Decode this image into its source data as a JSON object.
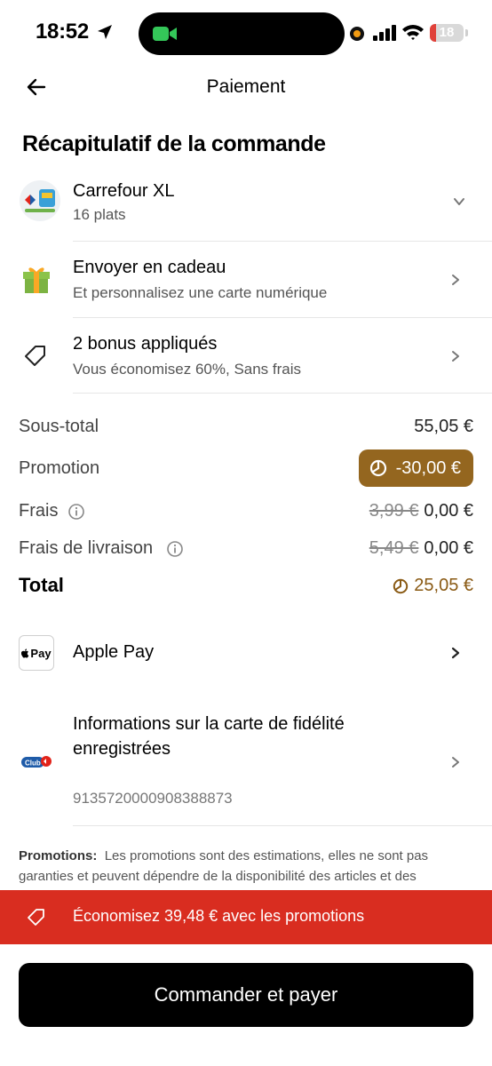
{
  "status_bar": {
    "time": "18:52",
    "battery": "18",
    "battery_level": 0.18
  },
  "header": {
    "title": "Paiement"
  },
  "summary": {
    "title": "Récapitulatif de la commande",
    "store": {
      "name": "Carrefour XL",
      "items": "16 plats"
    },
    "gift": {
      "title": "Envoyer en cadeau",
      "subtitle": "Et personnalisez une carte numérique"
    },
    "bonus": {
      "title": "2 bonus appliqués",
      "subtitle": "Vous économisez 60%, Sans frais"
    }
  },
  "pricing": {
    "subtotal_label": "Sous-total",
    "subtotal_value": "55,05 €",
    "promotion_label": "Promotion",
    "promotion_value": "-30,00 €",
    "fees_label": "Frais",
    "fees_old": "3,99 €",
    "fees_value": "0,00 €",
    "delivery_label": "Frais de livraison",
    "delivery_old": "5,49 €",
    "delivery_value": "0,00 €",
    "total_label": "Total",
    "total_value": "25,05 €"
  },
  "payment": {
    "method_badge": "Pay",
    "method_label": "Apple Pay"
  },
  "loyalty": {
    "logo_text": "Club",
    "title_line1": "Informations sur la carte de fidélité",
    "title_line2": "enregistrées",
    "number": "9135720000908388873"
  },
  "disclaimer": {
    "label": "Promotions:",
    "text": "Les promotions sont des estimations, elles ne sont pas garanties et peuvent dépendre de la disponibilité des articles et des"
  },
  "banner": {
    "text": "Économisez 39,48 € avec les promotions",
    "color": "#d92d20"
  },
  "cta": {
    "label": "Commander et payer"
  },
  "colors": {
    "promo_gold": "#94661f",
    "total_gold": "#8a5a14"
  }
}
